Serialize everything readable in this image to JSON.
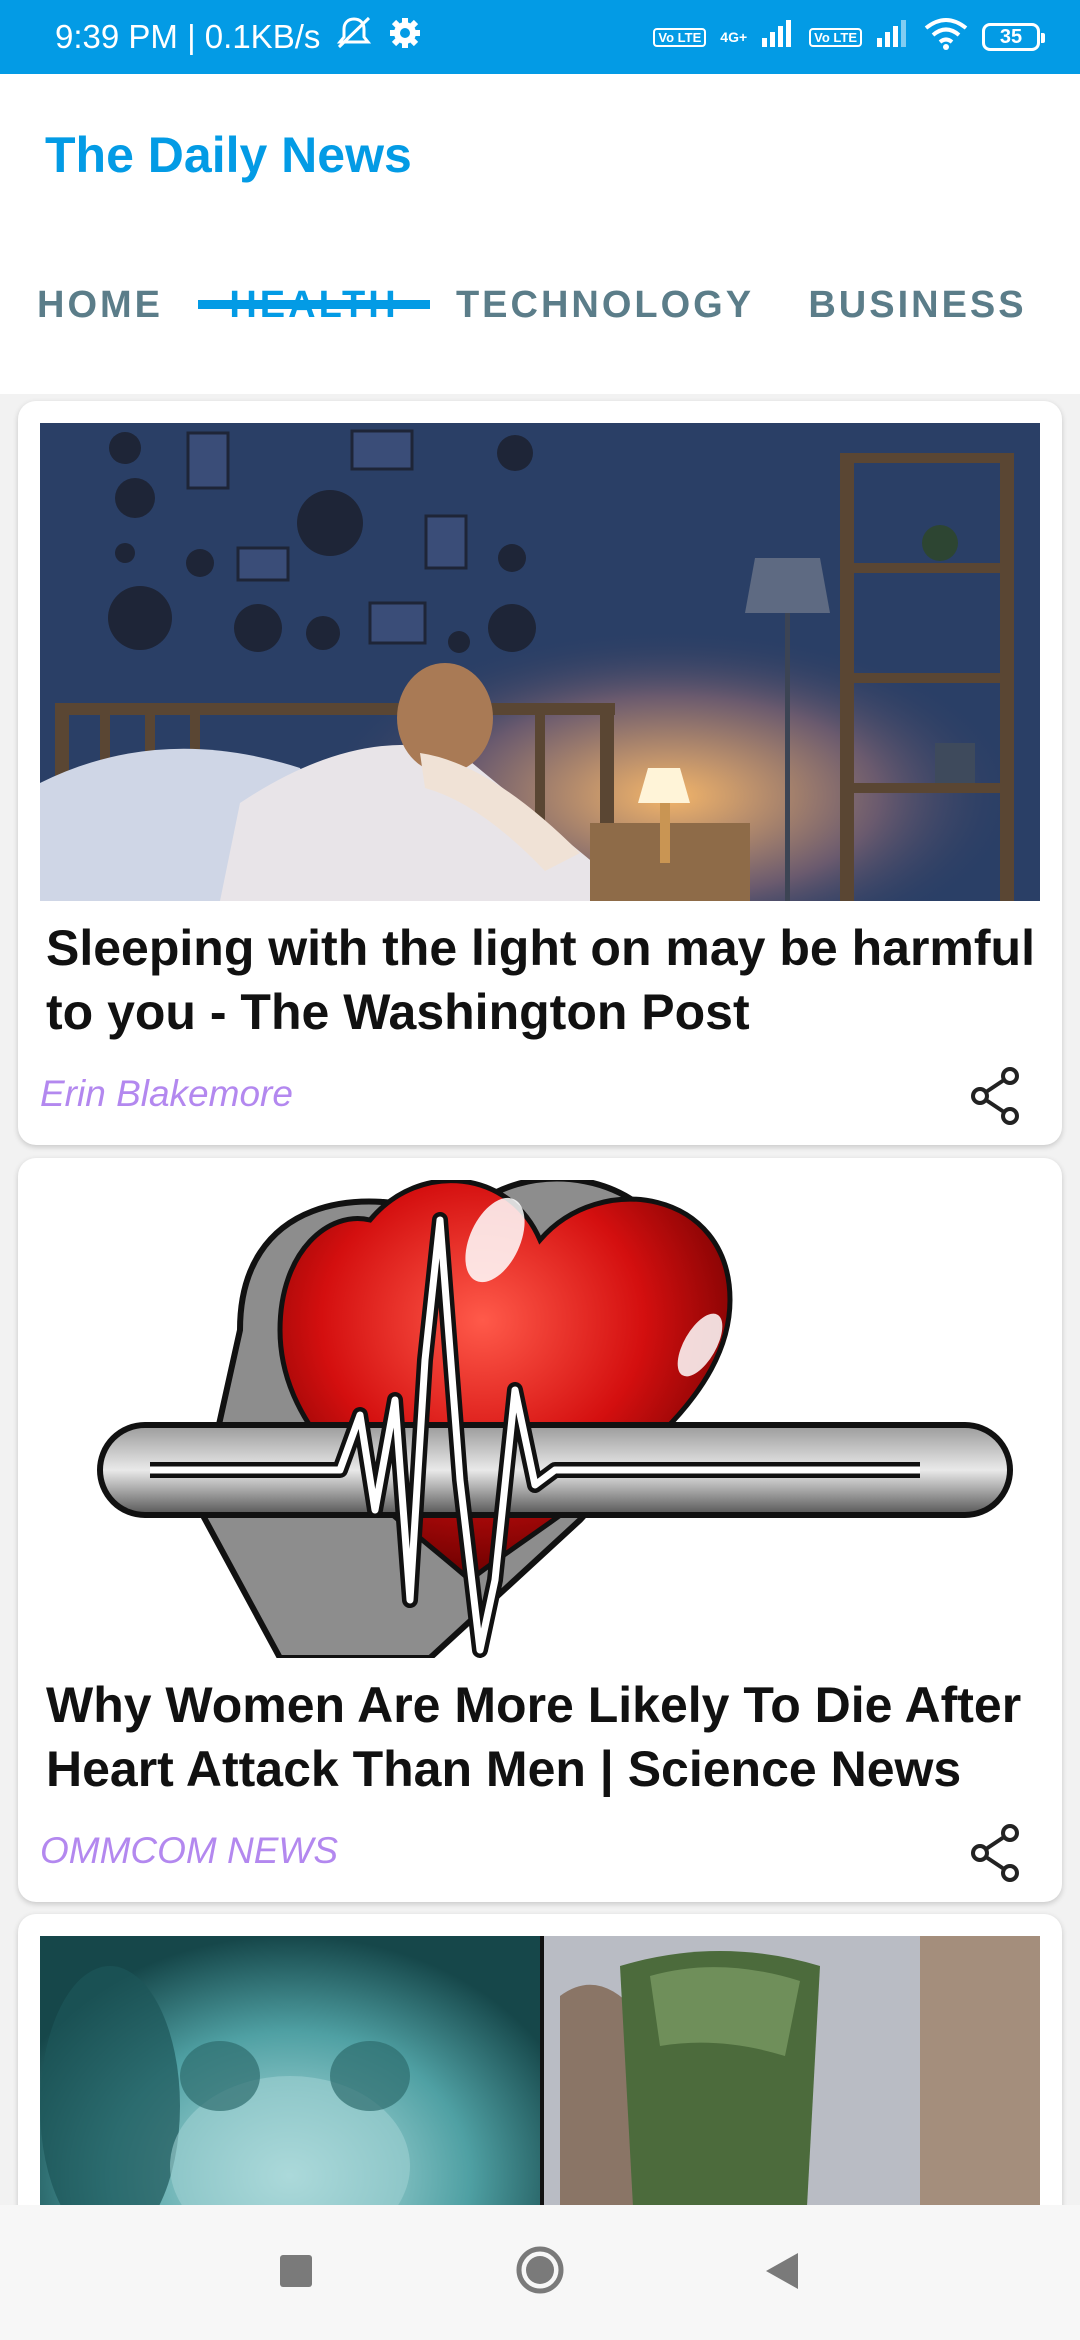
{
  "status_bar": {
    "time": "9:39 PM | 0.1KB/s",
    "battery": "35",
    "volte1": "Vo LTE",
    "volte2": "Vo LTE",
    "network": "4G+"
  },
  "app": {
    "title": "The Daily News"
  },
  "tabs": [
    {
      "label": "HOME"
    },
    {
      "label": "HEALTH",
      "active": true
    },
    {
      "label": "TECHNOLOGY"
    },
    {
      "label": "BUSINESS"
    }
  ],
  "articles": [
    {
      "title": "Sleeping with the light on may be harmful to you - The Washington Post",
      "author": "Erin Blakemore",
      "image": "woman-bed-lamp-night"
    },
    {
      "title": "Why Women Are More Likely To Die After Heart Attack Than Men | Science News",
      "author": "OMMCOM NEWS",
      "image": "heart-ecg-pulse"
    },
    {
      "title": "",
      "author": "",
      "image": "xray-and-artifact"
    }
  ],
  "colors": {
    "accent": "#039be5",
    "author": "#b388ef",
    "tab_inactive": "#5b7d89"
  }
}
